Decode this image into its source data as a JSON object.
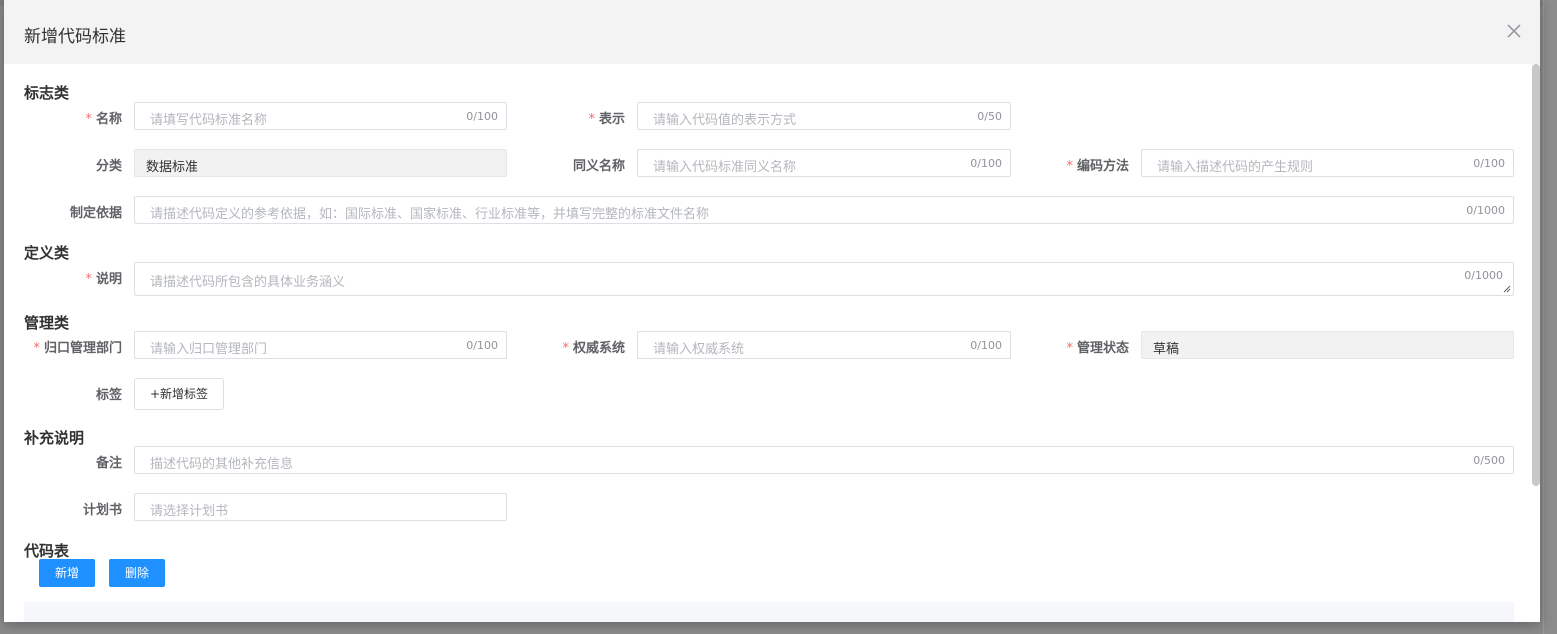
{
  "dialog": {
    "title": "新增代码标准"
  },
  "sections": {
    "flag": "标志类",
    "definition": "定义类",
    "management": "管理类",
    "supplement": "补充说明",
    "code_table": "代码表"
  },
  "fields": {
    "name": {
      "label": "名称",
      "placeholder": "请填写代码标准名称",
      "counter": "0/100",
      "required": true
    },
    "representation": {
      "label": "表示",
      "placeholder": "请输入代码值的表示方式",
      "counter": "0/50",
      "required": true
    },
    "category": {
      "label": "分类",
      "value": "数据标准"
    },
    "synonym": {
      "label": "同义名称",
      "placeholder": "请输入代码标准同义名称",
      "counter": "0/100"
    },
    "encoding": {
      "label": "编码方法",
      "placeholder": "请输入描述代码的产生规则",
      "counter": "0/100",
      "required": true
    },
    "basis": {
      "label": "制定依据",
      "placeholder": "请描述代码定义的参考依据，如：国际标准、国家标准、行业标准等，并填写完整的标准文件名称",
      "counter": "0/1000"
    },
    "description": {
      "label": "说明",
      "placeholder": "请描述代码所包含的具体业务涵义",
      "counter": "0/1000",
      "required": true
    },
    "department": {
      "label": "归口管理部门",
      "placeholder": "请输入归口管理部门",
      "counter": "0/100",
      "required": true
    },
    "authority": {
      "label": "权威系统",
      "placeholder": "请输入权威系统",
      "counter": "0/100",
      "required": true
    },
    "status": {
      "label": "管理状态",
      "value": "草稿",
      "required": true
    },
    "tags": {
      "label": "标签",
      "button": "+新增标签"
    },
    "remarks": {
      "label": "备注",
      "placeholder": "描述代码的其他补充信息",
      "counter": "0/500"
    },
    "plan": {
      "label": "计划书",
      "placeholder": "请选择计划书"
    }
  },
  "buttons": {
    "add": "新增",
    "delete": "删除"
  },
  "colors": {
    "primary": "#1e90ff",
    "required": "#f56c6c"
  }
}
